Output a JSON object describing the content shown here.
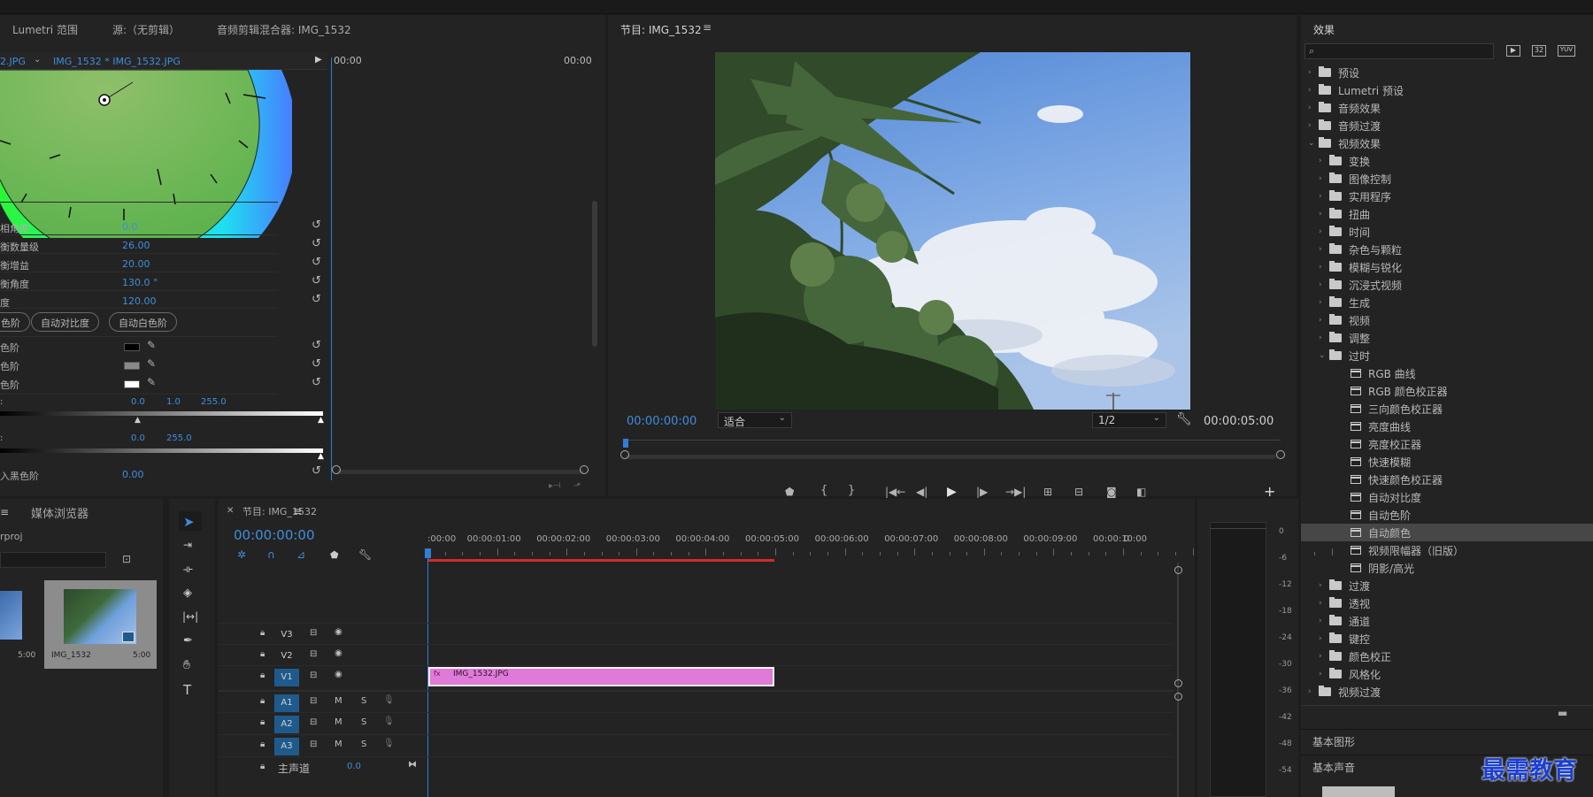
{
  "lumetri_panel": {
    "tabs": [
      "Lumetri 范围",
      "源:（无剪辑）",
      "音频剪辑混合器: IMG_1532"
    ],
    "clip_selector": "2.JPG",
    "clip_dropdown": "IMG_1532 * IMG_1532.JPG",
    "timecode_start": "00:00",
    "timecode_end": "00:00",
    "params": [
      {
        "label": "相角度",
        "value": "0.0"
      },
      {
        "label": "衡数量级",
        "value": "26.00"
      },
      {
        "label": "衡增益",
        "value": "20.00"
      },
      {
        "label": "衡角度",
        "value": "130.0 °"
      },
      {
        "label": "度",
        "value": "120.00"
      }
    ],
    "auto_buttons": [
      "色阶",
      "自动对比度",
      "自动白色阶"
    ],
    "levels": [
      {
        "label": "色阶",
        "swatch": "#000000"
      },
      {
        "label": "色阶",
        "swatch": "#8a8a8a"
      },
      {
        "label": "色阶",
        "swatch": "#ffffff"
      }
    ],
    "input_levels": [
      "0.0",
      "1.0",
      "255.0"
    ],
    "output_levels": [
      "0.0",
      "255.0"
    ],
    "last_param": {
      "label": "入黑色阶",
      "value": "0.00"
    }
  },
  "program_monitor": {
    "title": "节目: IMG_1532",
    "timecode_current": "00:00:00:00",
    "fit": "适合",
    "resolution": "1/2",
    "timecode_duration": "00:00:05:00"
  },
  "effects_panel": {
    "title": "效果",
    "search_placeholder": "",
    "filter_labels": [
      "32",
      "YUV"
    ],
    "tree": [
      {
        "label": "预设",
        "level": 0,
        "kind": "preset"
      },
      {
        "label": "Lumetri 预设",
        "level": 0,
        "kind": "preset"
      },
      {
        "label": "音频效果",
        "level": 0,
        "kind": "folder"
      },
      {
        "label": "音频过渡",
        "level": 0,
        "kind": "folder"
      },
      {
        "label": "视频效果",
        "level": 0,
        "kind": "folder",
        "open": true
      },
      {
        "label": "变换",
        "level": 1,
        "kind": "folder"
      },
      {
        "label": "图像控制",
        "level": 1,
        "kind": "folder"
      },
      {
        "label": "实用程序",
        "level": 1,
        "kind": "folder"
      },
      {
        "label": "扭曲",
        "level": 1,
        "kind": "folder"
      },
      {
        "label": "时间",
        "level": 1,
        "kind": "folder"
      },
      {
        "label": "杂色与颗粒",
        "level": 1,
        "kind": "folder"
      },
      {
        "label": "模糊与锐化",
        "level": 1,
        "kind": "folder"
      },
      {
        "label": "沉浸式视频",
        "level": 1,
        "kind": "folder"
      },
      {
        "label": "生成",
        "level": 1,
        "kind": "folder"
      },
      {
        "label": "视频",
        "level": 1,
        "kind": "folder"
      },
      {
        "label": "调整",
        "level": 1,
        "kind": "folder"
      },
      {
        "label": "过时",
        "level": 1,
        "kind": "folder",
        "open": true
      },
      {
        "label": "RGB 曲线",
        "level": 2,
        "kind": "fx"
      },
      {
        "label": "RGB 颜色校正器",
        "level": 2,
        "kind": "fx"
      },
      {
        "label": "三向颜色校正器",
        "level": 2,
        "kind": "fx"
      },
      {
        "label": "亮度曲线",
        "level": 2,
        "kind": "fx"
      },
      {
        "label": "亮度校正器",
        "level": 2,
        "kind": "fx"
      },
      {
        "label": "快速模糊",
        "level": 2,
        "kind": "fx"
      },
      {
        "label": "快速颜色校正器",
        "level": 2,
        "kind": "fx"
      },
      {
        "label": "自动对比度",
        "level": 2,
        "kind": "fx"
      },
      {
        "label": "自动色阶",
        "level": 2,
        "kind": "fx"
      },
      {
        "label": "自动颜色",
        "level": 2,
        "kind": "fx",
        "selected": true
      },
      {
        "label": "视频限幅器（旧版）",
        "level": 2,
        "kind": "fx"
      },
      {
        "label": "阴影/高光",
        "level": 2,
        "kind": "fx"
      },
      {
        "label": "过渡",
        "level": 1,
        "kind": "folder"
      },
      {
        "label": "透视",
        "level": 1,
        "kind": "folder"
      },
      {
        "label": "通道",
        "level": 1,
        "kind": "folder"
      },
      {
        "label": "键控",
        "level": 1,
        "kind": "folder"
      },
      {
        "label": "颜色校正",
        "level": 1,
        "kind": "folder"
      },
      {
        "label": "风格化",
        "level": 1,
        "kind": "folder"
      },
      {
        "label": "视频过渡",
        "level": 0,
        "kind": "folder"
      }
    ],
    "sections": [
      "基本图形",
      "基本声音"
    ],
    "watermark": "最需教育"
  },
  "project_panel": {
    "tab": "媒体浏览器",
    "project_name": "rproj",
    "items": [
      {
        "name": "",
        "duration": "5:00"
      },
      {
        "name": "IMG_1532",
        "duration": "5:00"
      }
    ]
  },
  "timeline": {
    "timecode": "00:00:00:00",
    "ruler": [
      ":00:00",
      "00:00:01:00",
      "00:00:02:00",
      "00:00:03:00",
      "00:00:04:00",
      "00:00:05:00",
      "00:00:06:00",
      "00:00:07:00",
      "00:00:08:00",
      "00:00:09:00",
      "00:00:10:00",
      "0"
    ],
    "video_tracks": [
      "V3",
      "V2",
      "V1"
    ],
    "audio_tracks": [
      "A1",
      "A2",
      "A3"
    ],
    "master_label": "主声道",
    "master_value": "0.0",
    "clip": {
      "label": "IMG_1532.JPG",
      "color": "#e07ad8"
    }
  },
  "audio_meter": {
    "scale": [
      "0",
      "-6",
      "-12",
      "-18",
      "-24",
      "-30",
      "-36",
      "-42",
      "-48",
      "-54"
    ]
  }
}
